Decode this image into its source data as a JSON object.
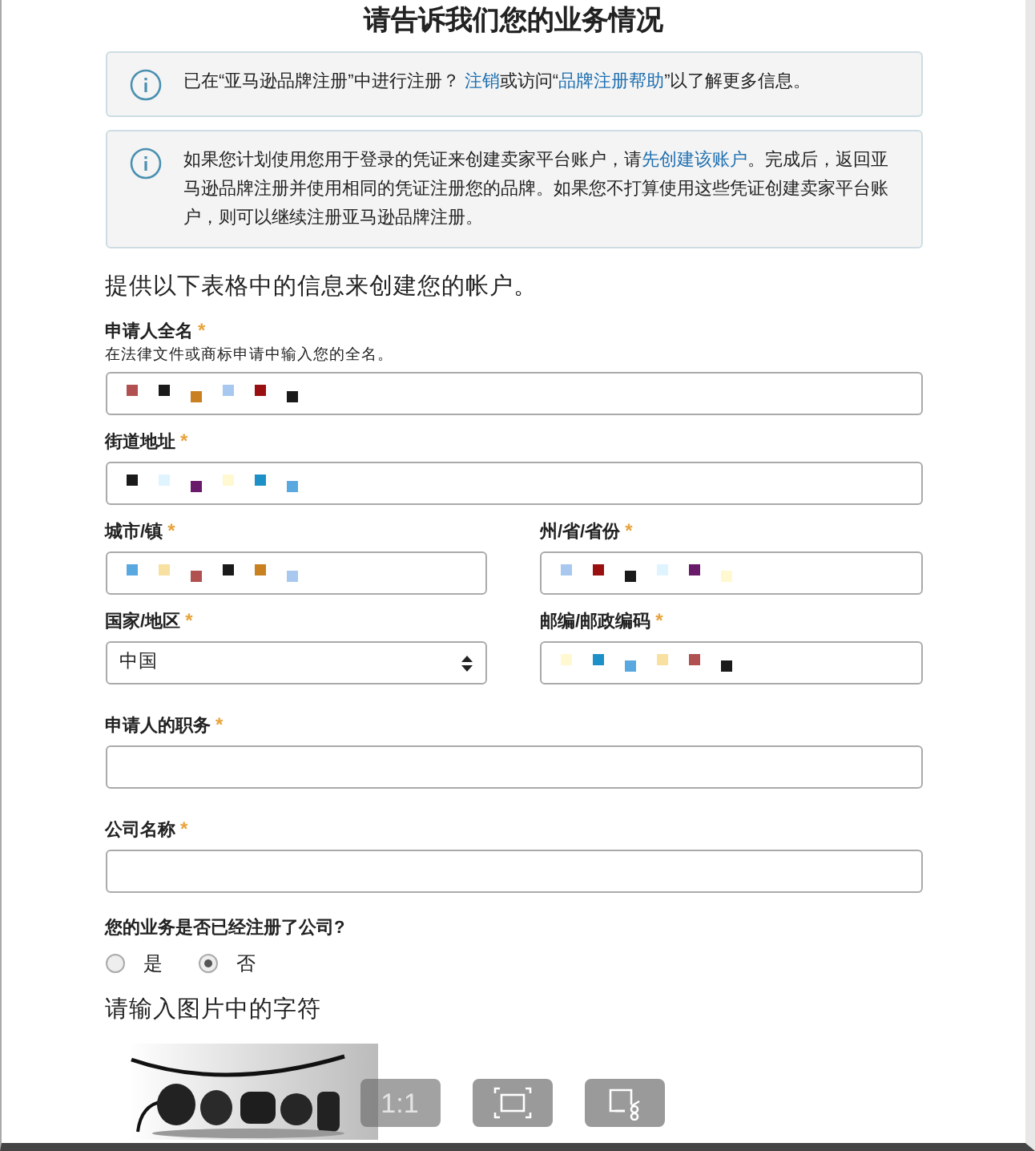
{
  "title": "请告诉我们您的业务情况",
  "notices": [
    {
      "parts": [
        {
          "text": "已在“亚马逊品牌注册”中进行注册？ "
        },
        {
          "text": "注销",
          "link": true
        },
        {
          "text": "或访问“"
        },
        {
          "text": "品牌注册帮助",
          "link": true
        },
        {
          "text": "”以了解更多信息。"
        }
      ]
    },
    {
      "parts": [
        {
          "text": "如果您计划使用您用于登录的凭证来创建卖家平台账户，请"
        },
        {
          "text": "先创建该账户",
          "link": true
        },
        {
          "text": "。完成后，返回亚马逊品牌注册并使用相同的凭证注册您的品牌。如果您不打算使用这些凭证创建卖家平台账户，则可以继续注册亚马逊品牌注册。"
        }
      ]
    }
  ],
  "intro": "提供以下表格中的信息来创建您的帐户。",
  "rows": [
    [
      {
        "kind": "text",
        "label": "申请人全名",
        "mark": "*",
        "hint": "在法律文件或商标申请中输入您的全名。",
        "masked": true
      }
    ],
    [
      {
        "kind": "text",
        "label": "街道地址",
        "mark": "*",
        "masked": true
      }
    ],
    [
      {
        "kind": "text",
        "label": "城市/镇",
        "mark": "*",
        "masked": true
      },
      {
        "kind": "text",
        "label": "州/省/省份",
        "mark": "*",
        "masked": true
      }
    ],
    [
      {
        "kind": "select",
        "label": "国家/地区",
        "mark": "*",
        "value": "中国"
      },
      {
        "kind": "text",
        "label": "邮编/邮政编码",
        "mark": "*",
        "masked": true
      }
    ],
    [
      {
        "kind": "text",
        "label": "申请人的职务",
        "mark": "*",
        "masked": false
      }
    ],
    [
      {
        "kind": "text",
        "label": "公司名称",
        "mark": "*",
        "masked": false
      }
    ]
  ],
  "question": {
    "label": "您的业务是否已经注册了公司?",
    "options": [
      {
        "label": "是",
        "selected": false
      },
      {
        "label": "否",
        "selected": true
      }
    ]
  },
  "captcha": {
    "label": "请输入图片中的字符"
  },
  "viewer_toolbar": [
    {
      "kind": "text",
      "label": "1:1",
      "disabled": true
    },
    {
      "kind": "fit"
    },
    {
      "kind": "snip"
    }
  ]
}
